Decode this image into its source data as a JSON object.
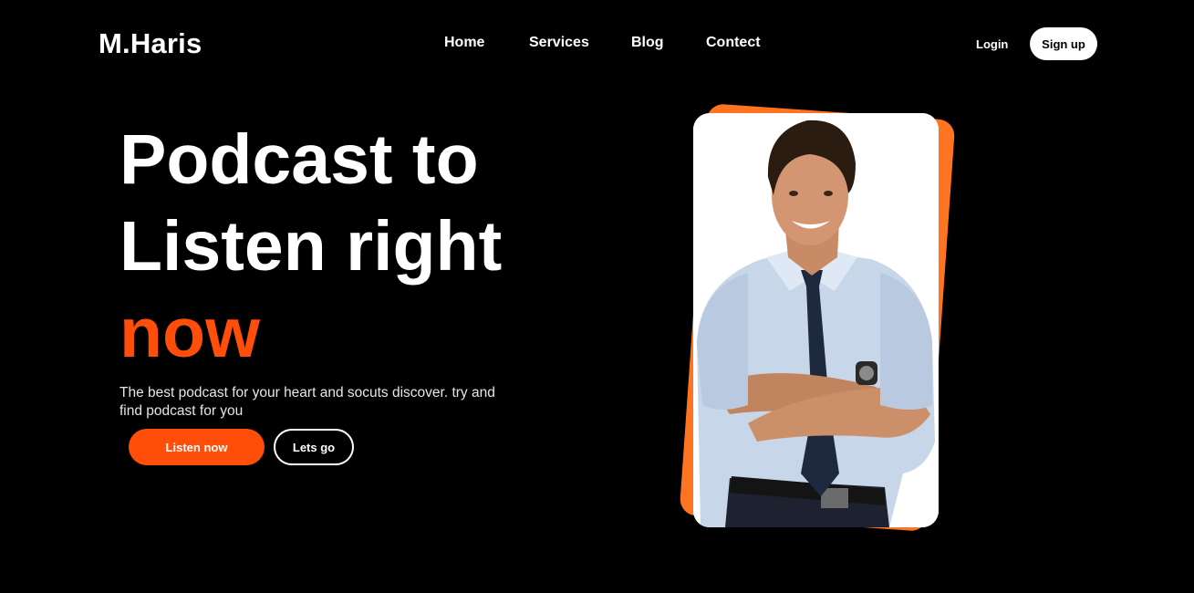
{
  "brand": {
    "logo": "M.Haris"
  },
  "nav": {
    "items": [
      {
        "label": "Home"
      },
      {
        "label": "Services"
      },
      {
        "label": "Blog"
      },
      {
        "label": "Contect"
      }
    ]
  },
  "auth": {
    "login_label": "Login",
    "signup_label": "Sign up"
  },
  "hero": {
    "title_line1": "Podcast to",
    "title_line2": "Listen right",
    "title_accent": "now",
    "subtitle": "The best podcast for your heart and socuts discover. try and find podcast for you",
    "primary_button": "Listen now",
    "secondary_button": "Lets go",
    "image": {
      "icon": "podcast-host-photo"
    }
  },
  "colors": {
    "accent": "#ff4d0a",
    "card_back": "#ff7420",
    "background": "#000000"
  }
}
